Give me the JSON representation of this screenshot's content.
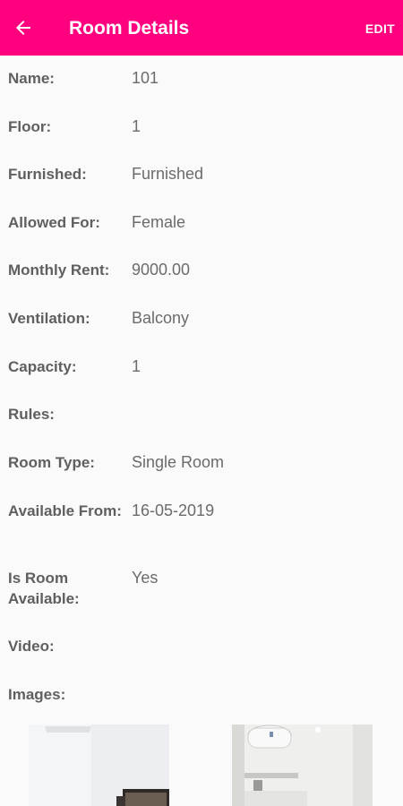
{
  "appbar": {
    "title": "Room Details",
    "edit_label": "EDIT",
    "back_icon": "arrow-left-icon"
  },
  "details": [
    {
      "label": "Name:",
      "value": "101"
    },
    {
      "label": "Floor:",
      "value": "1"
    },
    {
      "label": "Furnished:",
      "value": "Furnished"
    },
    {
      "label": "Allowed For:",
      "value": "Female"
    },
    {
      "label": "Monthly Rent:",
      "value": "9000.00"
    },
    {
      "label": "Ventilation:",
      "value": "Balcony"
    },
    {
      "label": "Capacity:",
      "value": "1"
    },
    {
      "label": "Rules:",
      "value": ""
    },
    {
      "label": "Room Type:",
      "value": "Single Room"
    },
    {
      "label": "Available From:",
      "value": "16-05-2019"
    },
    {
      "label": "Is Room Available:",
      "value": "Yes"
    },
    {
      "label": "Video:",
      "value": ""
    },
    {
      "label": "Images:",
      "value": ""
    }
  ],
  "colors": {
    "appbar": "#ff007f",
    "label": "#5f5f5f",
    "value": "#6b6b6b",
    "background": "#fafafa"
  }
}
